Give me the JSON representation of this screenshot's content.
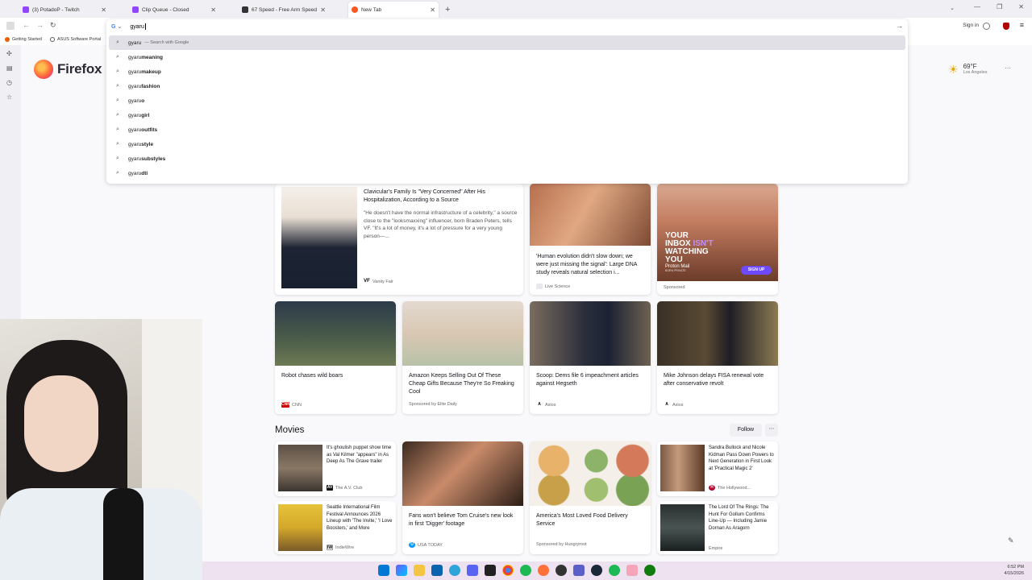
{
  "tabs": [
    {
      "title": "(3) PotadoP - Twitch",
      "color": "#9146ff",
      "active": false
    },
    {
      "title": "Clip Queue - Closed",
      "color": "#9146ff",
      "active": false
    },
    {
      "title": "67 Speed - Free Arm Speed Clic",
      "color": "#333333",
      "active": false
    },
    {
      "title": "New Tab",
      "color": "#ff5722",
      "active": true
    }
  ],
  "window": {
    "new_tab": "+",
    "tab_list": "⌄",
    "minimize": "—",
    "restore": "❐",
    "close": "✕"
  },
  "nav": {
    "back": "←",
    "forward": "→",
    "reload": "↻",
    "engine_letter": "G",
    "engine_caret": "⌄",
    "url_text": "gyaru",
    "go": "→",
    "signin": "Sign in",
    "menu": "≡"
  },
  "suggestions": [
    {
      "prefix": "gyaru",
      "bold": "",
      "hint": "— Search with Google"
    },
    {
      "prefix": "gyaru ",
      "bold": "meaning",
      "hint": ""
    },
    {
      "prefix": "gyaru ",
      "bold": "makeup",
      "hint": ""
    },
    {
      "prefix": "gyaru ",
      "bold": "fashion",
      "hint": ""
    },
    {
      "prefix": "gyaru",
      "bold": "o",
      "hint": ""
    },
    {
      "prefix": "gyaru ",
      "bold": "girl",
      "hint": ""
    },
    {
      "prefix": "gyaru ",
      "bold": "outfits",
      "hint": ""
    },
    {
      "prefix": "gyaru ",
      "bold": "style",
      "hint": ""
    },
    {
      "prefix": "gyaru ",
      "bold": "substyles",
      "hint": ""
    },
    {
      "prefix": "gyaru ",
      "bold": "dti",
      "hint": ""
    }
  ],
  "bookmarks": [
    {
      "label": "Getting Started",
      "color": "#e66000"
    },
    {
      "label": "ASUS Software Portal",
      "color": "#555555"
    }
  ],
  "brand": {
    "word": "Firefox"
  },
  "weather": {
    "temp": "69°F",
    "location": "Los Angeles",
    "menu": "⋯"
  },
  "cards": {
    "clavicular": {
      "title": "Clavicular's Family Is \"Very Concerned\" After His Hospitalization, According to a Source",
      "desc": "\"He doesn't have the normal infrastructure of a celebrity,\" a source close to the \"looksmaxxing\" influencer, born Braden Peters, tells VF. \"It's a lot of money, it's a lot of pressure for a very young person—...",
      "source": "Vanity Fair",
      "logo": "VF"
    },
    "evolution": {
      "title": "'Human evolution didn't slow down; we were just missing the signal': Large DNA study reveals natural selection i...",
      "source": "Live Science"
    },
    "protonmail": {
      "ad_line1": "YOUR",
      "ad_line2": "INBOX",
      "ad_line3": "ISN'T",
      "ad_line4": "WATCHING",
      "ad_line5": "YOU",
      "brand": "Proton Mail",
      "brand_sub": "BORN PRIVATE",
      "cta": "SIGN UP",
      "source": "Sponsored"
    },
    "robot": {
      "title": "Robot chases wild boars",
      "source": "CNN",
      "logo": "CNN"
    },
    "amazon": {
      "title": "Amazon Keeps Selling Out Of These Cheap Gifts Because They're So Freaking Cool",
      "source": "Sponsored by Elite Daily"
    },
    "dems": {
      "title": "Scoop: Dems file 6 impeachment articles against Hegseth",
      "source": "Axios",
      "logo": "A"
    },
    "mike": {
      "title": "Mike Johnson delays FISA renewal vote after conservative revolt",
      "source": "Axios",
      "logo": "A"
    },
    "valkilmer": {
      "title": "It's ghoulish puppet show time as Val Kilmer \"appears\" in As Deep As The Grave trailer",
      "source": "The A.V. Club",
      "logo": "AV"
    },
    "sandra": {
      "title": "Sandra Bullock and Nicole Kidman Pass Down Powers to Next Generation in First Look at 'Practical Magic 2'",
      "source": "The Hollywood...",
      "logo": "H"
    },
    "seattle": {
      "title": "Seattle International Film Festival Announces 2026 Lineup with 'The Invite,' 'I Love Boosters,' and More",
      "source": "IndieWire",
      "logo": "IW"
    },
    "tomcruise": {
      "title": "Fans won't believe Tom Cruise's new look in first 'Digger' footage",
      "source": "USA TODAY",
      "logo": "U"
    },
    "food": {
      "title": "America's Most Loved Food Delivery Service",
      "source": "Sponsored by Hungryroot"
    },
    "lotr": {
      "title": "The Lord Of The Rings: The Hunt For Gollum Confirms Line-Up — Including Jamie Dornan As Aragorn",
      "source": "Empire",
      "logo": "E"
    }
  },
  "section": {
    "title": "Movies",
    "follow": "Follow",
    "more": "⋯"
  },
  "customize_icon": "✎",
  "taskbar": {
    "time": "6:52 PM",
    "date": "4/15/2026"
  }
}
